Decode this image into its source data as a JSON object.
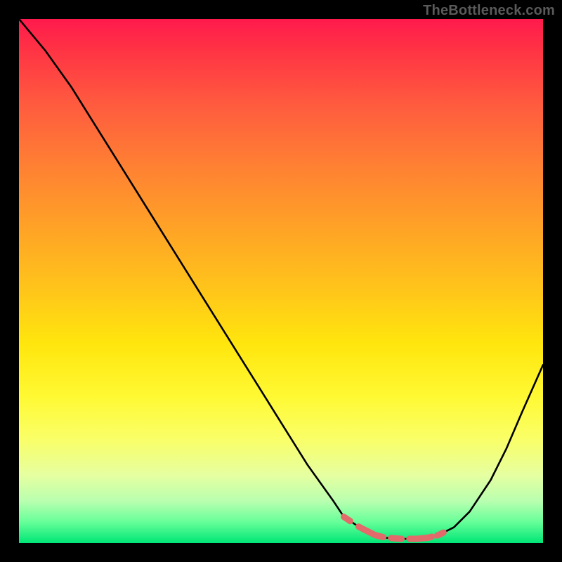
{
  "watermark": "TheBottleneck.com",
  "colors": {
    "curve": "#000000",
    "highlight": "#e36a6a",
    "gradient_top": "#ff1a4d",
    "gradient_bottom": "#00e676",
    "frame": "#000000"
  },
  "chart_data": {
    "type": "line",
    "title": "",
    "xlabel": "",
    "ylabel": "",
    "xlim": [
      0,
      100
    ],
    "ylim": [
      0,
      100
    ],
    "grid": false,
    "legend": false,
    "series": [
      {
        "name": "bottleneck_curve",
        "x": [
          0,
          5,
          10,
          15,
          20,
          25,
          30,
          35,
          40,
          45,
          50,
          55,
          60,
          62,
          65,
          68,
          70,
          73,
          76,
          78,
          80,
          83,
          86,
          90,
          93,
          96,
          100
        ],
        "y": [
          100,
          94,
          87,
          79,
          71,
          63,
          55,
          47,
          39,
          31,
          23,
          15,
          8,
          5,
          3,
          1.5,
          1,
          0.8,
          0.8,
          1,
          1.5,
          3,
          6,
          12,
          18,
          25,
          34
        ]
      }
    ],
    "highlight_range_x": [
      62,
      80
    ],
    "highlight_dashes": [
      {
        "x0": 62.0,
        "x1": 63.2
      },
      {
        "x0": 64.8,
        "x1": 69.5
      },
      {
        "x0": 71.0,
        "x1": 73.0
      },
      {
        "x0": 74.5,
        "x1": 78.8
      },
      {
        "x0": 79.8,
        "x1": 81.0
      }
    ]
  }
}
